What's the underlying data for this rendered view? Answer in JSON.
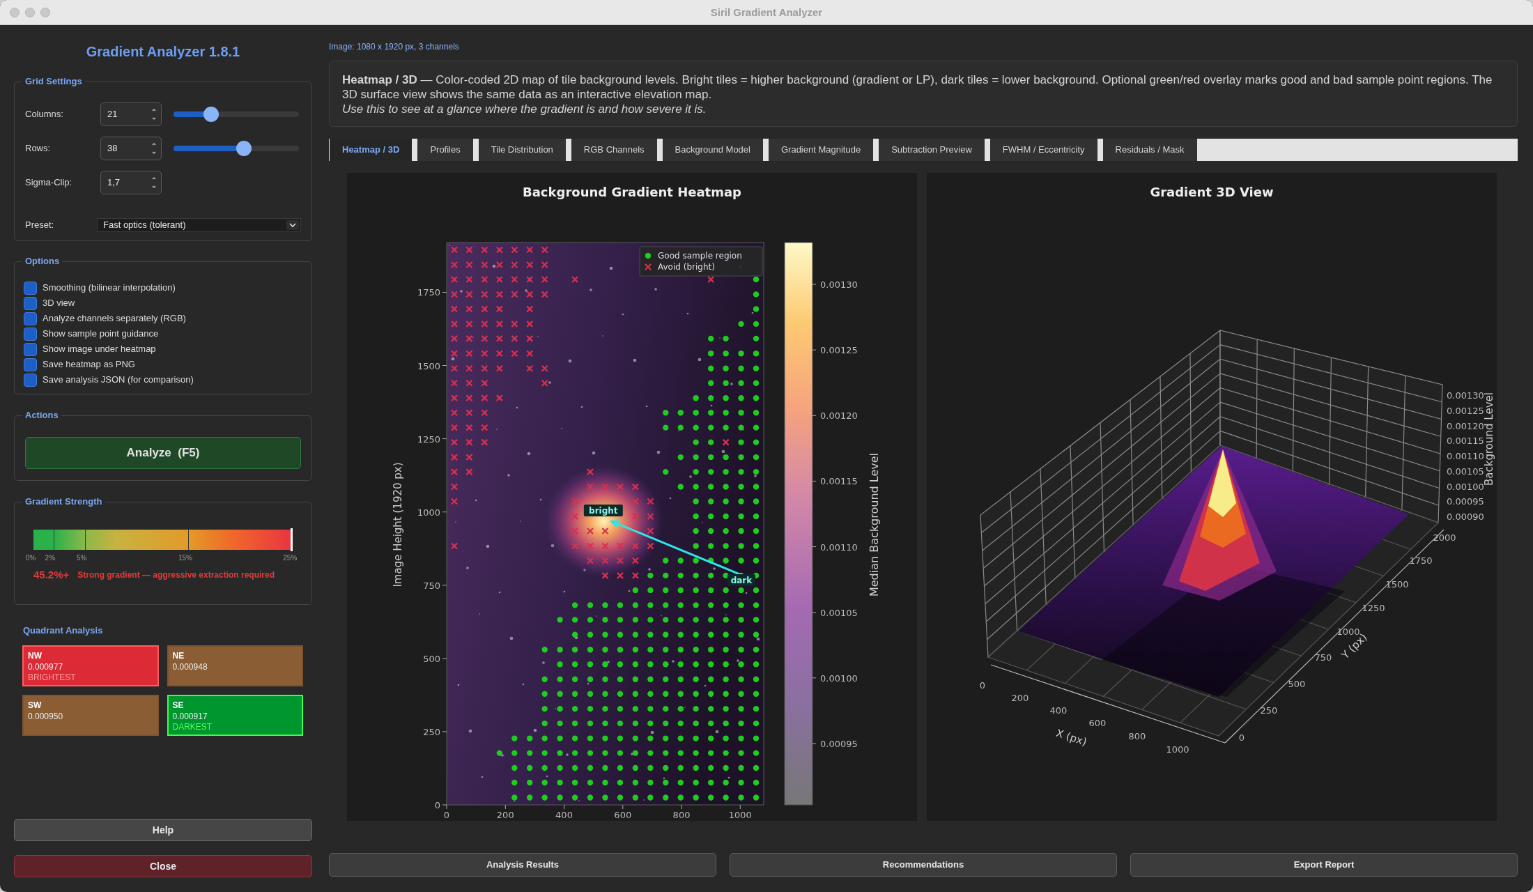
{
  "window": {
    "title": "Siril Gradient Analyzer"
  },
  "sidebar": {
    "title": "Gradient Analyzer 1.8.1",
    "grid_settings": {
      "title": "Grid Settings",
      "fields": [
        {
          "kind": "spin_slider",
          "label": "Columns:",
          "value": "21",
          "level": 0.3
        },
        {
          "kind": "spin_slider",
          "label": "Rows:",
          "value": "38",
          "level": 0.56
        },
        {
          "kind": "spin",
          "label": "Sigma-Clip:",
          "value": "1,7"
        }
      ],
      "preset": {
        "label": "Preset:",
        "value": "Fast optics (tolerant)"
      }
    },
    "options": {
      "title": "Options",
      "items": [
        {
          "label": "Smoothing (bilinear interpolation)",
          "checked": true
        },
        {
          "label": "3D view",
          "checked": true
        },
        {
          "label": "Analyze channels separately (RGB)",
          "checked": true
        },
        {
          "label": "Show sample point guidance",
          "checked": true
        },
        {
          "label": "Show image under heatmap",
          "checked": true
        },
        {
          "label": "Save heatmap as PNG",
          "checked": true
        },
        {
          "label": "Save analysis JSON (for comparison)",
          "checked": true
        }
      ]
    },
    "actions": {
      "title": "Actions",
      "button": "Analyze  (F5)"
    },
    "gradient_strength": {
      "title": "Gradient Strength",
      "level": 1.0,
      "ticks": [
        "0%",
        "2%",
        "5%",
        "15%",
        "25%"
      ],
      "value": "45.2%+",
      "verdict": "Strong gradient — aggressive extraction required"
    },
    "quadrants": {
      "title": "Quadrant Analysis",
      "cells": [
        {
          "kind": "brightest",
          "label": "NW",
          "value": "0.000977",
          "tag": "BRIGHTEST"
        },
        {
          "kind": "neutral",
          "label": "NE",
          "value": "0.000948"
        },
        {
          "kind": "neutral",
          "label": "SW",
          "value": "0.000950"
        },
        {
          "kind": "darkest",
          "label": "SE",
          "value": "0.000917",
          "tag": "DARKEST"
        }
      ]
    },
    "buttons": [
      {
        "kind": "neutral",
        "label": "Help"
      },
      {
        "kind": "danger",
        "label": "Close"
      }
    ]
  },
  "main": {
    "image_info": "Image: 1080 x 1920 px, 3 channels",
    "description": "**Heatmap / 3D** — Color-coded 2D map of tile background levels. Bright tiles = higher background (gradient or LP), dark tiles = lower background. Optional green/red overlay marks good and bad sample point regions. The 3D surface view shows the same data as an interactive elevation map.",
    "hint": "Use this to see at a glance where the gradient is and how severe it is.",
    "tabs": [
      {
        "label": "Heatmap / 3D",
        "selected": true
      },
      {
        "label": "Profiles",
        "selected": false
      },
      {
        "label": "Tile Distribution",
        "selected": false
      },
      {
        "label": "RGB Channels",
        "selected": false
      },
      {
        "label": "Background Model",
        "selected": false
      },
      {
        "label": "Gradient Magnitude",
        "selected": false
      },
      {
        "label": "Subtraction Preview",
        "selected": false
      },
      {
        "label": "FWHM / Eccentricity",
        "selected": false
      },
      {
        "label": "Residuals / Mask",
        "selected": false
      }
    ],
    "heatmap": {
      "chart_data": {
        "type": "scatter",
        "title": "Background Gradient Heatmap",
        "ylabel": "Image Height (1920 px)",
        "xlim": [
          0,
          1080
        ],
        "ylim": [
          0,
          1920
        ],
        "xticks": [
          {
            "value": 0,
            "label": "0"
          },
          {
            "value": 200,
            "label": "200"
          },
          {
            "value": 400,
            "label": "400"
          },
          {
            "value": 600,
            "label": "600"
          },
          {
            "value": 800,
            "label": "800"
          },
          {
            "value": 1000,
            "label": "1000"
          }
        ],
        "yticks": [
          {
            "value": 1750,
            "label": "1750"
          },
          {
            "value": 1500,
            "label": "1500"
          },
          {
            "value": 1250,
            "label": "1250"
          },
          {
            "value": 1000,
            "label": "1000"
          },
          {
            "value": 750,
            "label": "750"
          },
          {
            "value": 500,
            "label": "500"
          },
          {
            "value": 250,
            "label": "250"
          },
          {
            "value": 0,
            "label": "0"
          }
        ],
        "series": [
          {
            "name": "Good sample region",
            "marker": "o",
            "color": "#1fcc1f",
            "x": [
              1054,
              1054,
              1054,
              1003,
              1054,
              900,
              951,
              1054,
              900,
              951,
              1003,
              1054,
              900,
              951,
              1003,
              1054,
              900,
              951,
              1003,
              1054,
              849,
              900,
              951,
              1003,
              1054,
              746,
              797,
              849,
              900,
              951,
              1003,
              1054,
              746,
              797,
              849,
              900,
              951,
              1003,
              1054,
              849,
              900,
              1003,
              1054,
              797,
              849,
              900,
              951,
              1003,
              1054,
              746,
              849,
              900,
              951,
              1003,
              1054,
              797,
              849,
              900,
              951,
              1003,
              1054,
              849,
              900,
              951,
              1003,
              1054,
              849,
              900,
              951,
              1003,
              1054,
              849,
              900,
              951,
              1003,
              1054,
              849,
              900,
              951,
              1003,
              1054,
              746,
              797,
              849,
              900,
              951,
              1003,
              1054,
              694,
              746,
              797,
              849,
              900,
              951,
              1003,
              1054,
              643,
              694,
              746,
              797,
              849,
              900,
              951,
              1003,
              1054,
              437,
              489,
              540,
              591,
              643,
              694,
              746,
              797,
              849,
              900,
              951,
              1003,
              1054,
              386,
              437,
              489,
              540,
              591,
              643,
              694,
              746,
              797,
              849,
              900,
              951,
              1003,
              1054,
              437,
              489,
              540,
              591,
              643,
              694,
              746,
              797,
              849,
              900,
              951,
              1003,
              1054,
              334,
              386,
              437,
              489,
              540,
              591,
              643,
              694,
              746,
              797,
              849,
              900,
              951,
              1003,
              1054,
              386,
              437,
              489,
              540,
              591,
              643,
              694,
              746,
              797,
              849,
              900,
              951,
              1003,
              1054,
              334,
              386,
              437,
              489,
              540,
              591,
              643,
              694,
              746,
              797,
              849,
              900,
              951,
              1003,
              1054,
              334,
              386,
              437,
              489,
              540,
              591,
              643,
              694,
              746,
              797,
              849,
              900,
              951,
              1003,
              1054,
              334,
              386,
              437,
              489,
              540,
              591,
              643,
              694,
              746,
              797,
              849,
              900,
              951,
              1003,
              1054,
              334,
              386,
              437,
              489,
              540,
              591,
              643,
              694,
              746,
              797,
              849,
              900,
              951,
              1003,
              1054,
              231,
              283,
              334,
              386,
              437,
              489,
              540,
              591,
              643,
              694,
              746,
              797,
              849,
              900,
              951,
              1003,
              1054,
              180,
              231,
              283,
              334,
              386,
              437,
              489,
              540,
              591,
              643,
              694,
              746,
              797,
              849,
              900,
              951,
              1003,
              1054,
              231,
              283,
              334,
              386,
              437,
              489,
              540,
              591,
              643,
              694,
              746,
              797,
              849,
              900,
              951,
              1003,
              1054,
              231,
              283,
              334,
              386,
              437,
              489,
              540,
              591,
              643,
              694,
              746,
              797,
              849,
              900,
              951,
              1003,
              1054,
              231,
              283,
              334,
              386,
              437,
              489,
              540,
              591,
              643,
              694,
              746,
              797,
              849,
              900,
              951,
              1003,
              1054
            ],
            "values": [
              1794,
              1743,
              1693,
              1642,
              1642,
              1592,
              1592,
              1592,
              1541,
              1541,
              1541,
              1541,
              1490,
              1490,
              1490,
              1490,
              1440,
              1440,
              1440,
              1440,
              1389,
              1389,
              1389,
              1389,
              1389,
              1339,
              1339,
              1339,
              1339,
              1339,
              1339,
              1339,
              1288,
              1288,
              1288,
              1288,
              1288,
              1288,
              1288,
              1238,
              1238,
              1238,
              1238,
              1187,
              1187,
              1187,
              1187,
              1187,
              1187,
              1137,
              1137,
              1137,
              1137,
              1137,
              1137,
              1086,
              1086,
              1086,
              1086,
              1086,
              1086,
              1036,
              1036,
              1036,
              1036,
              1036,
              985,
              985,
              985,
              985,
              985,
              935,
              935,
              935,
              935,
              935,
              884,
              884,
              884,
              884,
              884,
              834,
              834,
              834,
              834,
              834,
              834,
              834,
              783,
              783,
              783,
              783,
              783,
              783,
              783,
              783,
              733,
              733,
              733,
              733,
              733,
              733,
              733,
              733,
              733,
              682,
              682,
              682,
              682,
              682,
              682,
              682,
              682,
              682,
              682,
              682,
              682,
              682,
              632,
              632,
              632,
              632,
              632,
              632,
              632,
              632,
              632,
              632,
              632,
              632,
              632,
              632,
              581,
              581,
              581,
              581,
              581,
              581,
              581,
              581,
              581,
              581,
              581,
              581,
              581,
              530,
              530,
              530,
              530,
              530,
              530,
              530,
              530,
              530,
              530,
              530,
              530,
              530,
              530,
              530,
              480,
              480,
              480,
              480,
              480,
              480,
              480,
              480,
              480,
              480,
              480,
              480,
              480,
              480,
              429,
              429,
              429,
              429,
              429,
              429,
              429,
              429,
              429,
              429,
              429,
              429,
              429,
              429,
              429,
              379,
              379,
              379,
              379,
              379,
              379,
              379,
              379,
              379,
              379,
              379,
              379,
              379,
              379,
              379,
              328,
              328,
              328,
              328,
              328,
              328,
              328,
              328,
              328,
              328,
              328,
              328,
              328,
              328,
              328,
              278,
              278,
              278,
              278,
              278,
              278,
              278,
              278,
              278,
              278,
              278,
              278,
              278,
              278,
              278,
              227,
              227,
              227,
              227,
              227,
              227,
              227,
              227,
              227,
              227,
              227,
              227,
              227,
              227,
              227,
              227,
              227,
              177,
              177,
              177,
              177,
              177,
              177,
              177,
              177,
              177,
              177,
              177,
              177,
              177,
              177,
              177,
              177,
              177,
              177,
              126,
              126,
              126,
              126,
              126,
              126,
              126,
              126,
              126,
              126,
              126,
              126,
              126,
              126,
              126,
              126,
              126,
              76,
              76,
              76,
              76,
              76,
              76,
              76,
              76,
              76,
              76,
              76,
              76,
              76,
              76,
              76,
              76,
              76,
              25,
              25,
              25,
              25,
              25,
              25,
              25,
              25,
              25,
              25,
              25,
              25,
              25,
              25,
              25,
              25,
              25
            ]
          },
          {
            "name": "Avoid (bright)",
            "marker": "x",
            "color": "#d8304f",
            "x": [
              26,
              77,
              129,
              180,
              231,
              283,
              334,
              26,
              77,
              129,
              180,
              231,
              283,
              334,
              26,
              77,
              129,
              180,
              231,
              283,
              334,
              437,
              900,
              26,
              77,
              129,
              180,
              231,
              283,
              334,
              26,
              77,
              129,
              180,
              283,
              26,
              77,
              129,
              180,
              231,
              283,
              26,
              77,
              129,
              180,
              231,
              283,
              26,
              77,
              129,
              180,
              231,
              283,
              26,
              77,
              129,
              180,
              283,
              334,
              26,
              77,
              129,
              334,
              26,
              77,
              129,
              180,
              26,
              77,
              129,
              26,
              77,
              129,
              26,
              77,
              129,
              951,
              26,
              77,
              26,
              77,
              489,
              26,
              489,
              540,
              591,
              643,
              26,
              437,
              643,
              694,
              437,
              643,
              694,
              437,
              489,
              540,
              643,
              694,
              26,
              437,
              489,
              540,
              591,
              643,
              694,
              489,
              540,
              591,
              643,
              540,
              591,
              643
            ],
            "values": [
              1895,
              1895,
              1895,
              1895,
              1895,
              1895,
              1895,
              1844,
              1844,
              1844,
              1844,
              1844,
              1844,
              1844,
              1794,
              1794,
              1794,
              1794,
              1794,
              1794,
              1794,
              1794,
              1794,
              1743,
              1743,
              1743,
              1743,
              1743,
              1743,
              1743,
              1693,
              1693,
              1693,
              1693,
              1693,
              1642,
              1642,
              1642,
              1642,
              1642,
              1642,
              1592,
              1592,
              1592,
              1592,
              1592,
              1592,
              1541,
              1541,
              1541,
              1541,
              1541,
              1541,
              1490,
              1490,
              1490,
              1490,
              1490,
              1490,
              1440,
              1440,
              1440,
              1440,
              1389,
              1389,
              1389,
              1389,
              1339,
              1339,
              1339,
              1288,
              1288,
              1288,
              1238,
              1238,
              1238,
              1238,
              1187,
              1187,
              1137,
              1137,
              1137,
              1086,
              1086,
              1086,
              1086,
              1086,
              1036,
              1036,
              1036,
              1036,
              985,
              985,
              985,
              935,
              935,
              935,
              935,
              935,
              884,
              884,
              884,
              884,
              884,
              884,
              884,
              834,
              834,
              834,
              834,
              783,
              783,
              783
            ]
          }
        ],
        "legend": "upper right",
        "annotations": [
          "bright",
          "dark"
        ]
      },
      "colorbar": {
        "label": "Median Background Level",
        "ticks": [
          "0.00130",
          "0.00125",
          "0.00120",
          "0.00115",
          "0.00110",
          "0.00105",
          "0.00100",
          "0.00095"
        ]
      }
    },
    "view_3d": {
      "title": "Gradient 3D View",
      "xlabel": "X (px)",
      "ylabel": "Y (px)",
      "zlabel": "Background Level",
      "xticks": [
        "0",
        "200",
        "400",
        "600",
        "800",
        "1000"
      ],
      "yticks": [
        "0",
        "250",
        "500",
        "750",
        "1000",
        "1250",
        "1500",
        "1750",
        "2000"
      ],
      "zticks": [
        "0.00130",
        "0.00125",
        "0.00120",
        "0.00115",
        "0.00110",
        "0.00105",
        "0.00100",
        "0.00095",
        "0.00090"
      ]
    },
    "buttons": [
      "Analysis Results",
      "Recommendations",
      "Export Report"
    ]
  }
}
